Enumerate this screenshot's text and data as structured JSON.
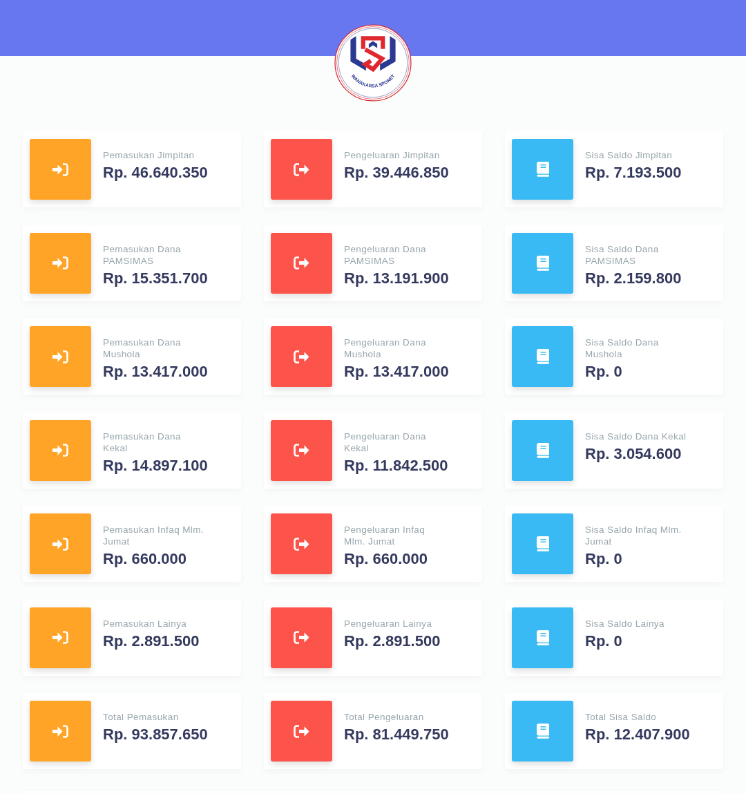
{
  "header": {
    "logo": {
      "text": "WANAKARSA SPORET"
    }
  },
  "stats": [
    {
      "kind": "income",
      "label": "Pemasukan Jimpitan",
      "value": "Rp. 46.640.350"
    },
    {
      "kind": "expense",
      "label": "Pengeluaran Jimpitan",
      "value": "Rp. 39.446.850"
    },
    {
      "kind": "balance",
      "label": "Sisa Saldo Jimpitan",
      "value": "Rp. 7.193.500"
    },
    {
      "kind": "income",
      "label": "Pemasukan Dana PAMSIMAS",
      "value": "Rp. 15.351.700"
    },
    {
      "kind": "expense",
      "label": "Pengeluaran Dana PAMSIMAS",
      "value": "Rp. 13.191.900"
    },
    {
      "kind": "balance",
      "label": "Sisa Saldo Dana PAMSIMAS",
      "value": "Rp. 2.159.800"
    },
    {
      "kind": "income",
      "label": "Pemasukan Dana Mushola",
      "value": "Rp. 13.417.000"
    },
    {
      "kind": "expense",
      "label": "Pengeluaran Dana Mushola",
      "value": "Rp. 13.417.000"
    },
    {
      "kind": "balance",
      "label": "Sisa Saldo Dana Mushola",
      "value": "Rp. 0"
    },
    {
      "kind": "income",
      "label": "Pemasukan Dana Kekal",
      "value": "Rp. 14.897.100"
    },
    {
      "kind": "expense",
      "label": "Pengeluaran Dana Kekal",
      "value": "Rp. 11.842.500"
    },
    {
      "kind": "balance",
      "label": "Sisa Saldo Dana Kekal",
      "value": "Rp. 3.054.600"
    },
    {
      "kind": "income",
      "label": "Pemasukan Infaq Mlm. Jumat",
      "value": "Rp. 660.000"
    },
    {
      "kind": "expense",
      "label": "Pengeluaran Infaq Mlm. Jumat",
      "value": "Rp. 660.000"
    },
    {
      "kind": "balance",
      "label": "Sisa Saldo Infaq Mlm. Jumat",
      "value": "Rp. 0"
    },
    {
      "kind": "income",
      "label": "Pemasukan Lainya",
      "value": "Rp. 2.891.500"
    },
    {
      "kind": "expense",
      "label": "Pengeluaran Lainya",
      "value": "Rp. 2.891.500"
    },
    {
      "kind": "balance",
      "label": "Sisa Saldo Lainya",
      "value": "Rp. 0"
    },
    {
      "kind": "income",
      "label": "Total Pemasukan",
      "value": "Rp. 93.857.650"
    },
    {
      "kind": "expense",
      "label": "Total Pengeluaran",
      "value": "Rp. 81.449.750"
    },
    {
      "kind": "balance",
      "label": "Total Sisa Saldo",
      "value": "Rp. 12.407.900"
    }
  ]
}
